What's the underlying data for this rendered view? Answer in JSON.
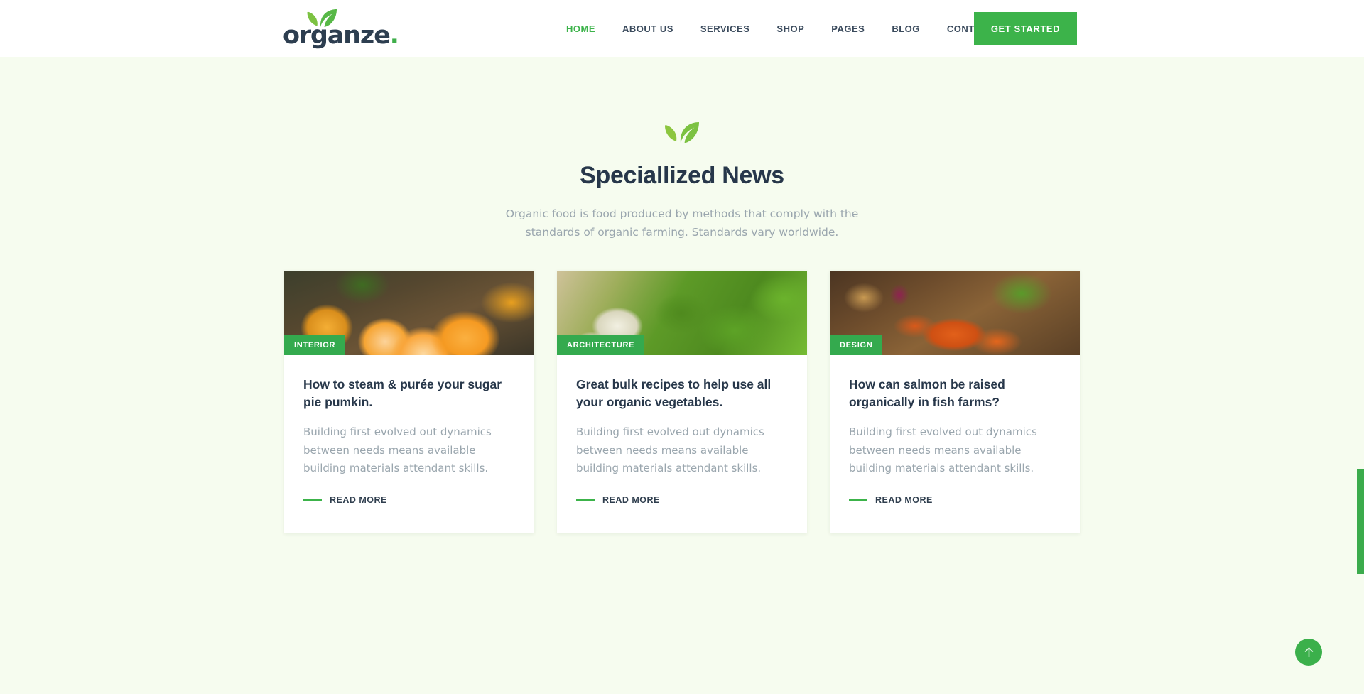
{
  "header": {
    "logo": {
      "text": "organze",
      "dot": ".",
      "leaf_icon": "leaf-icon"
    },
    "nav": [
      {
        "label": "HOME",
        "active": true
      },
      {
        "label": "ABOUT US",
        "active": false
      },
      {
        "label": "SERVICES",
        "active": false
      },
      {
        "label": "SHOP",
        "active": false
      },
      {
        "label": "PAGES",
        "active": false
      },
      {
        "label": "BLOG",
        "active": false
      },
      {
        "label": "CONTACT",
        "active": false
      }
    ],
    "cta_label": "GET STARTED"
  },
  "section": {
    "leaf_icon": "leaf-icon",
    "title": "Speciallized News",
    "subtitle": "Organic food is food produced by methods that comply with the standards of organic farming. Standards vary worldwide."
  },
  "cards": [
    {
      "badge": "INTERIOR",
      "title": "How to steam & purée your sugar pie pumkin.",
      "text": "Building first evolved out dynamics between needs means available building materials attendant skills.",
      "link_label": "READ MORE",
      "image_alt": "peeled mandarin oranges in a copper bowl"
    },
    {
      "badge": "ARCHITECTURE",
      "title": "Great bulk recipes to help use all your organic vegetables.",
      "text": "Building first evolved out dynamics between needs means available building materials attendant skills.",
      "link_label": "READ MORE",
      "image_alt": "white turnips with leafy greens in a wooden crate"
    },
    {
      "badge": "DESIGN",
      "title": "How can salmon be raised organically in fish farms?",
      "text": "Building first evolved out dynamics between needs means available building materials attendant skills.",
      "link_label": "READ MORE",
      "image_alt": "fresh carrots with tops on a wooden cutting board"
    }
  ],
  "scroll_top": {
    "icon": "arrow-up-icon",
    "label": "Back to top"
  },
  "colors": {
    "brand_green": "#3cb34a",
    "badge_green": "#34aa4e",
    "heading_navy": "#27374a",
    "body_gray": "#9aa6ae",
    "page_bg": "#f6fcef",
    "header_bg": "#ffffff",
    "card_bg": "#ffffff",
    "scrollbar_green": "#3bab4c"
  }
}
